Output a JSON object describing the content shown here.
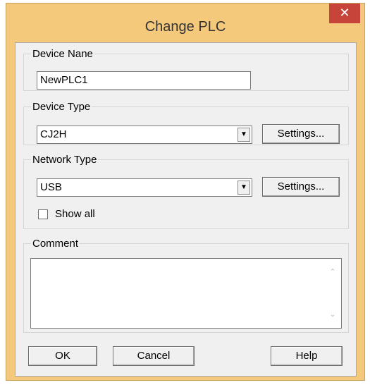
{
  "window": {
    "title": "Change PLC",
    "close_glyph": "✕"
  },
  "device_name": {
    "legend": "Device Nane",
    "value": "NewPLC1"
  },
  "device_type": {
    "legend": "Device Type",
    "selected": "CJ2H",
    "settings_label": "Settings..."
  },
  "network_type": {
    "legend": "Network Type",
    "selected": "USB",
    "settings_label": "Settings...",
    "show_all_label": "Show all",
    "show_all_checked": false
  },
  "comment": {
    "legend": "Comment",
    "value": ""
  },
  "buttons": {
    "ok": "OK",
    "cancel": "Cancel",
    "help": "Help"
  },
  "icons": {
    "combo_arrow": "▼",
    "scroll_up": "⌃",
    "scroll_down": "⌄",
    "close": "close-icon"
  },
  "colors": {
    "title_bar": "#f5c97c",
    "close_button": "#c7443b",
    "client_bg": "#f0f0f0"
  }
}
